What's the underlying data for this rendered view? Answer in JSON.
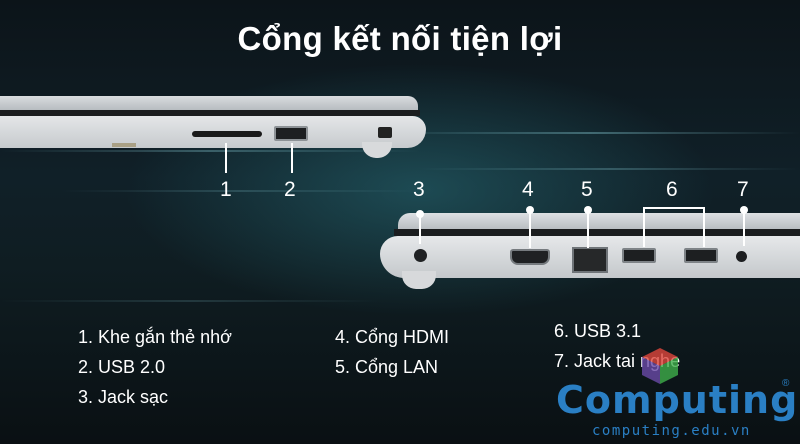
{
  "title": "Cổng kết nối tiện lợi",
  "callouts": [
    "1",
    "2",
    "3",
    "4",
    "5",
    "6",
    "7"
  ],
  "legend": {
    "col1": [
      "1. Khe gắn thẻ nhớ",
      "2. USB 2.0",
      "3. Jack sạc"
    ],
    "col2": [
      "4. Cổng HDMI",
      "5. Cổng LAN"
    ],
    "col3": [
      "6. USB 3.1",
      "7. Jack tai nghe"
    ]
  },
  "watermark": {
    "brand": "Computing",
    "registered": "®",
    "url": "computing.edu.vn"
  },
  "colors": {
    "background": "#0b1116",
    "text": "#ffffff",
    "brand": "#2a7fc4"
  }
}
